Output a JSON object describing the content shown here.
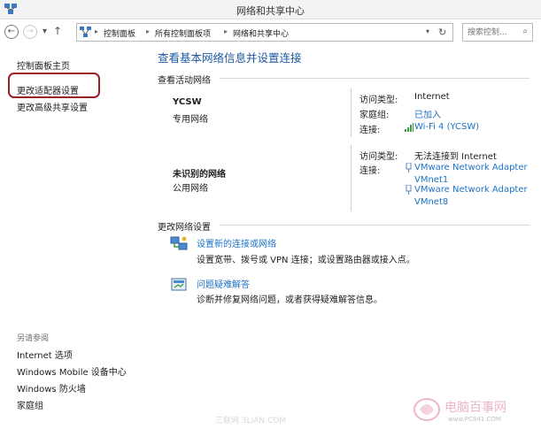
{
  "window": {
    "title": "网络和共享中心"
  },
  "address_bar": {
    "breadcrumbs": [
      "控制面板",
      "所有控制面板项",
      "网络和共享中心"
    ],
    "search_placeholder": "搜索控制..."
  },
  "left_pane": {
    "links": [
      "控制面板主页",
      "更改适配器设置",
      "更改高级共享设置"
    ],
    "see_also_heading": "另请参阅",
    "see_also": [
      "Internet 选项",
      "Windows Mobile 设备中心",
      "Windows 防火墙",
      "家庭组"
    ]
  },
  "main": {
    "title": "查看基本网络信息并设置连接",
    "active_heading": "查看活动网络",
    "networks": [
      {
        "name": "YCSW",
        "type": "专用网络",
        "access_label": "访问类型:",
        "access_value": "Internet",
        "homegroup_label": "家庭组:",
        "homegroup_value": "已加入",
        "connection_label": "连接:",
        "connection_value": "Wi-Fi 4 (YCSW)"
      },
      {
        "name": "未识别的网络",
        "type": "公用网络",
        "access_label": "访问类型:",
        "access_value": "无法连接到 Internet",
        "connection_label": "连接:",
        "connections": [
          "VMware Network Adapter",
          "VMnet1",
          "VMware Network Adapter",
          "VMnet8"
        ]
      }
    ],
    "change_heading": "更改网络设置",
    "tasks": [
      {
        "link": "设置新的连接或网络",
        "desc": "设置宽带、拨号或 VPN 连接；或设置路由器或接入点。",
        "icon": "network-setup-icon"
      },
      {
        "link": "问题疑难解答",
        "desc": "诊断并修复网络问题，或者获得疑难解答信息。",
        "icon": "troubleshoot-icon"
      }
    ]
  },
  "watermarks": {
    "logo_text": "电脑百事网",
    "logo_url": "www.PC841.COM",
    "site_text": "三联网 3LIAN.COM"
  },
  "colors": {
    "link": "#1d72c5",
    "title": "#1d5aa3",
    "highlight": "#9a1f24"
  }
}
